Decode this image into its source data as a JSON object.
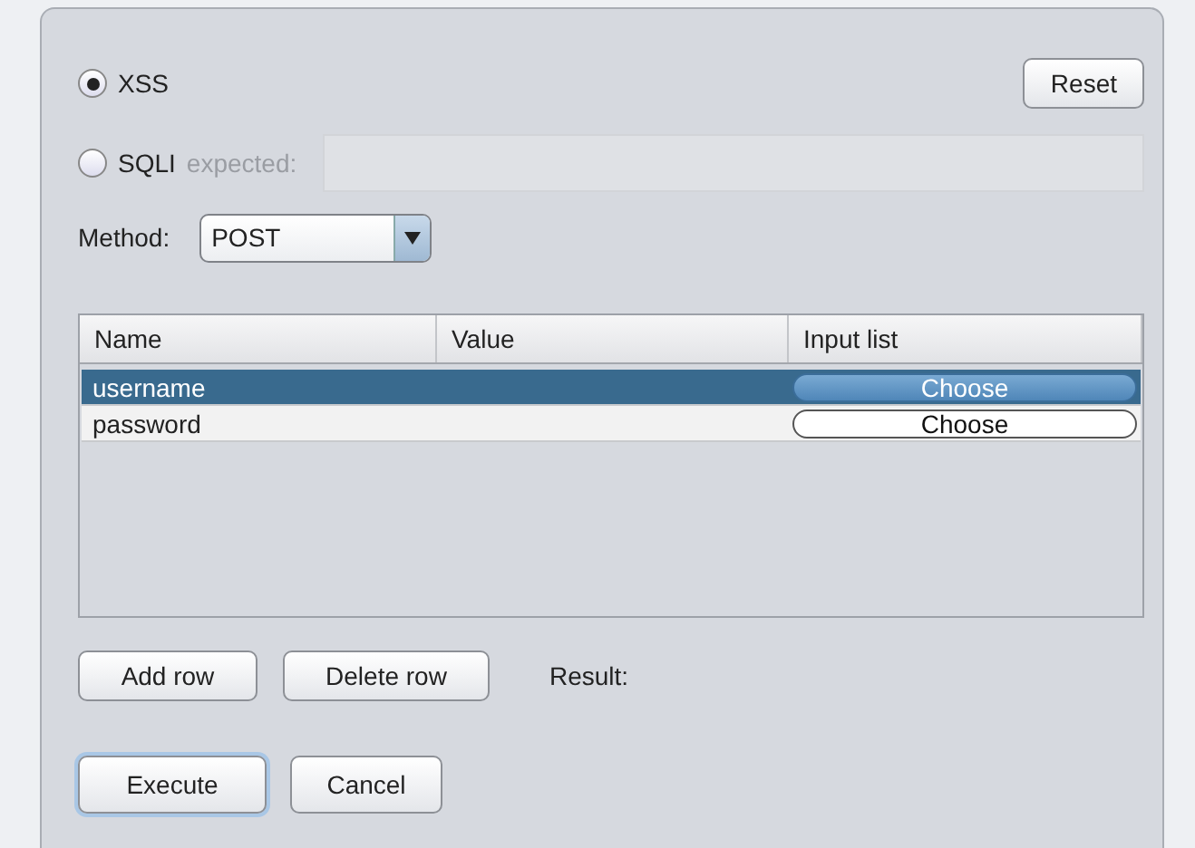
{
  "modes": [
    {
      "kind": "xss",
      "label": "XSS",
      "selected": true
    },
    {
      "kind": "sqli",
      "label": "SQLI",
      "selected": false,
      "hint": "expected:"
    }
  ],
  "reset_button": "Reset",
  "method": {
    "label": "Method:",
    "value": "POST"
  },
  "table": {
    "columns": [
      "Name",
      "Value",
      "Input list"
    ],
    "rows": [
      {
        "name": "username",
        "value": "",
        "button": "Choose",
        "selected": true
      },
      {
        "name": "password",
        "value": "",
        "button": "Choose",
        "selected": false
      }
    ]
  },
  "row_buttons": [
    "Add row",
    "Delete row"
  ],
  "result_label": "Result:",
  "actions": [
    {
      "label": "Execute",
      "default": true
    },
    {
      "label": "Cancel",
      "default": false
    }
  ]
}
